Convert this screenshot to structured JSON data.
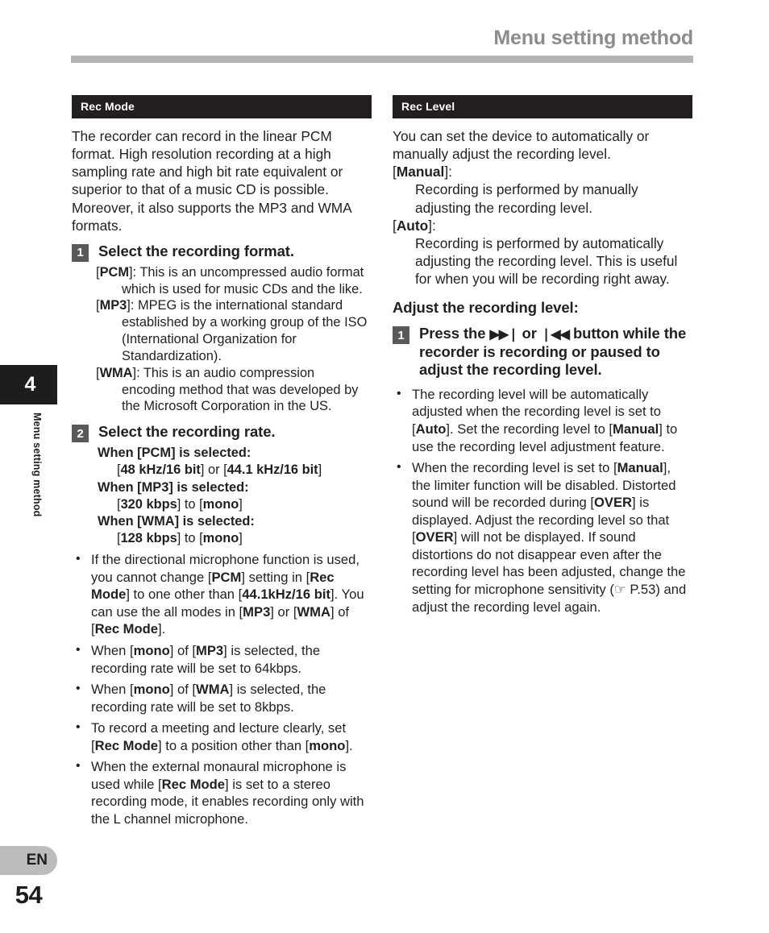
{
  "header": {
    "title": "Menu setting method"
  },
  "sidebar": {
    "chapter_number": "4",
    "chapter_label": "Menu setting method",
    "language_badge": "EN",
    "page_number": "54"
  },
  "left_column": {
    "section_title": "Rec Mode",
    "intro": "The recorder can record in the linear PCM format. High resolution recording at a high sampling rate and high bit rate equivalent or superior to that of a music CD is possible. Moreover, it also supports the MP3 and WMA formats.",
    "step1": {
      "number": "1",
      "title": "Select the recording format.",
      "definitions": [
        {
          "term": "PCM",
          "text": "This is an uncompressed audio format which is used for music CDs and the like."
        },
        {
          "term": "MP3",
          "text": "MPEG is the international standard established by a working group of the ISO (International Organization for Standardization)."
        },
        {
          "term": "WMA",
          "text": "This is an audio compression encoding method that was developed by the Microsoft Corporation in the US."
        }
      ]
    },
    "step2": {
      "number": "2",
      "title": "Select the recording rate.",
      "when_blocks": [
        {
          "head_prefix": "When [",
          "head_term": "PCM",
          "head_suffix": "] is selected:",
          "value": "[48 kHz/16 bit] or [44.1 kHz/16 bit]"
        },
        {
          "head_prefix": "When [",
          "head_term": "MP3",
          "head_suffix": "] is selected:",
          "value": "[320 kbps] to [mono]"
        },
        {
          "head_prefix": "When [",
          "head_term": "WMA",
          "head_suffix": "] is selected:",
          "value": "[128 kbps] to [mono]"
        }
      ]
    },
    "bullets": [
      "If the directional microphone function is used, you cannot change [PCM] setting in [Rec Mode] to one other than [44.1kHz/16 bit]. You can use the all modes in [MP3] or [WMA] of [Rec Mode].",
      "When [mono] of [MP3] is selected, the recording rate will be set to 64kbps.",
      "When [mono] of [WMA] is selected, the recording rate will be set to 8kbps.",
      "To record a meeting and lecture clearly, set [Rec Mode] to a position other than [mono].",
      "When the external monaural microphone is used while [Rec Mode] is set to a stereo recording mode, it enables recording only with the L channel microphone."
    ]
  },
  "right_column": {
    "section_title": "Rec Level",
    "intro": "You can set the device to automatically or manually adjust the recording level.",
    "modes": [
      {
        "label": "[Manual]:",
        "term": "Manual",
        "text": "Recording is performed by manually adjusting the recording level."
      },
      {
        "label": "[Auto]:",
        "term": "Auto",
        "text": "Recording is performed by automatically adjusting the recording level. This is useful for when you will be recording right away."
      }
    ],
    "sub_heading": "Adjust the recording level:",
    "step1": {
      "number": "1",
      "title_part1": "Press the",
      "glyph_forward": "▶▶❘",
      "title_or": "or",
      "glyph_back": "❘◀◀",
      "title_part2": "button while the recorder is recording or paused to adjust the recording level."
    },
    "bullets": [
      "The recording level will be automatically adjusted when the recording level is set to [Auto]. Set the recording level to [Manual] to use the recording level adjustment feature.",
      "When the recording level is set to [Manual], the limiter function will be disabled. Distorted sound will be recorded during [OVER] is displayed. Adjust the recording level so that [OVER] will not be displayed. If sound distortions do not disappear even after the recording level has been adjusted, change the setting for microphone sensitivity (☞ P.53) and adjust the recording level again."
    ],
    "page_ref": "P.53",
    "page_ref_icon": "☞"
  },
  "bullet_symbol": "•",
  "colors": {
    "section_bar": "#231f20",
    "step_number_box": "#58595b",
    "header_title": "#8c8c8c",
    "header_rule": "#b4b4b4",
    "chapter_tab": "#1d1d1d",
    "lang_badge": "#bcbcbc",
    "text": "#231f20"
  }
}
